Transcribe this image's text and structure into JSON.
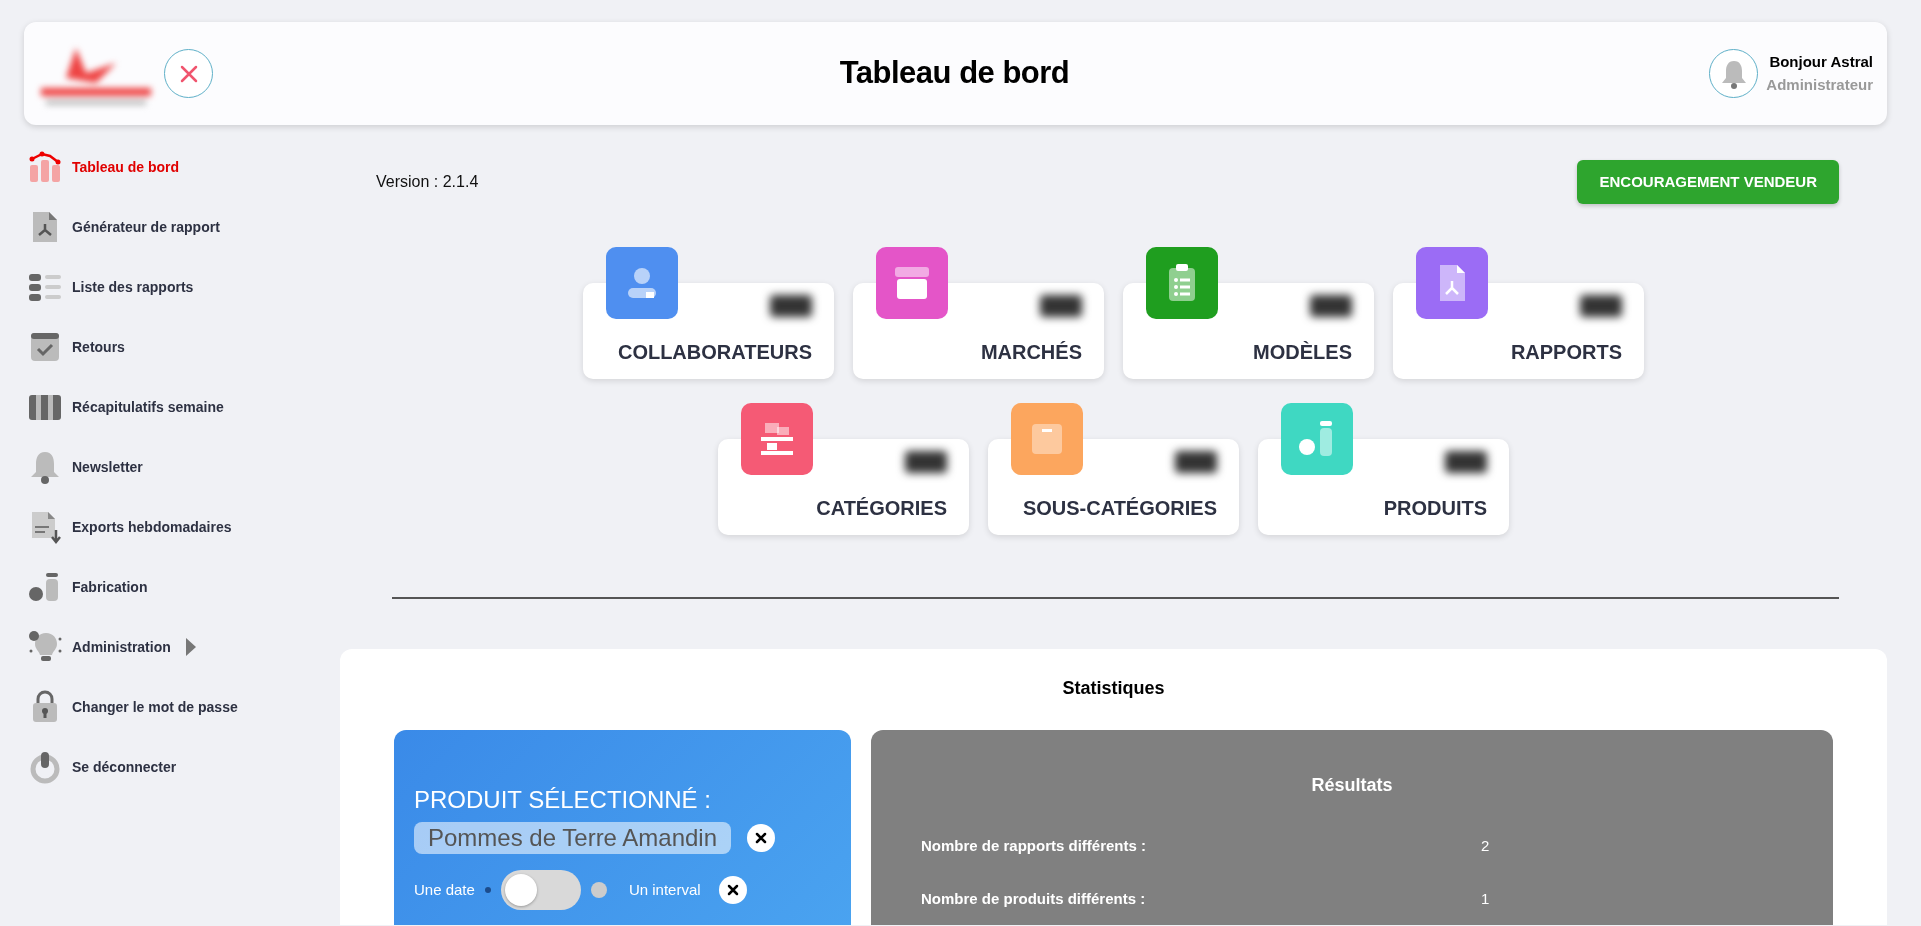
{
  "header": {
    "title": "Tableau de bord",
    "greeting": "Bonjour Astral",
    "role": "Administrateur"
  },
  "sidebar": {
    "items": [
      {
        "label": "Tableau de bord",
        "selected": true,
        "kind": "link"
      },
      {
        "label": "Générateur de rapport",
        "selected": false,
        "kind": "link"
      },
      {
        "label": "Liste des rapports",
        "selected": false,
        "kind": "link"
      },
      {
        "label": "Retours",
        "selected": false,
        "kind": "link"
      },
      {
        "label": "Récapitulatifs semaine",
        "selected": false,
        "kind": "link"
      },
      {
        "label": "Newsletter",
        "selected": false,
        "kind": "link"
      },
      {
        "label": "Exports hebdomadaires",
        "selected": false,
        "kind": "link"
      },
      {
        "label": "Fabrication",
        "selected": false,
        "kind": "link"
      },
      {
        "label": "Administration",
        "selected": false,
        "kind": "submenu"
      },
      {
        "label": "Changer le mot de passe",
        "selected": false,
        "kind": "link"
      },
      {
        "label": "Se déconnecter",
        "selected": false,
        "kind": "link"
      }
    ]
  },
  "version": "Version : 2.1.4",
  "action_button": "ENCOURAGEMENT VENDEUR",
  "stat_cards": [
    {
      "label": "COLLABORATEURS",
      "color": "#4f8ff0"
    },
    {
      "label": "MARCHÉS",
      "color": "#e455c8"
    },
    {
      "label": "MODÈLES",
      "color": "#1f9e1f"
    },
    {
      "label": "RAPPORTS",
      "color": "#9b6cf5"
    },
    {
      "label": "CATÉGORIES",
      "color": "#f55a75"
    },
    {
      "label": "SOUS-CATÉGORIES",
      "color": "#fca65e"
    },
    {
      "label": "PRODUITS",
      "color": "#3fd8c2"
    }
  ],
  "statistics": {
    "title": "Statistiques",
    "selection": {
      "heading": "PRODUIT SÉLECTIONNÉ :",
      "product": "Pommes de Terre Amandin",
      "toggle": {
        "left_label": "Une date",
        "right_label": "Un interval",
        "on": false
      }
    },
    "results": {
      "title": "Résultats",
      "rows": [
        {
          "label": "Nombre de rapports différents :",
          "value": "2"
        },
        {
          "label": "Nombre de produits différents :",
          "value": "1"
        }
      ]
    }
  }
}
